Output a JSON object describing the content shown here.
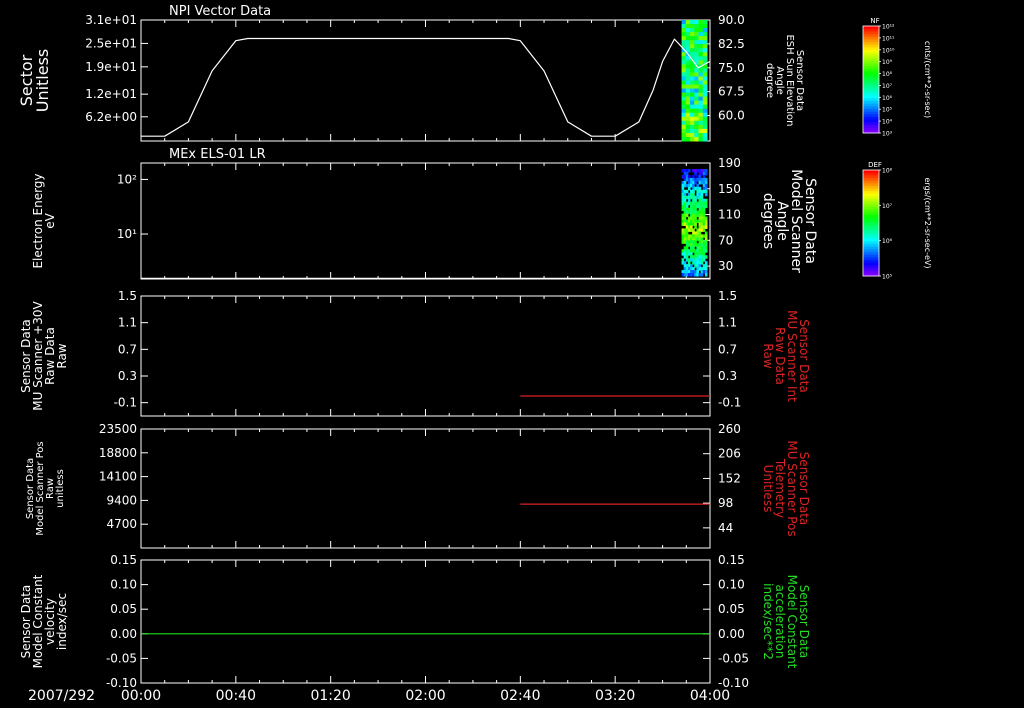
{
  "x_axis": {
    "date_label": "2007/292",
    "range": [
      0,
      240
    ],
    "ticks": [
      {
        "value": 0,
        "label": "00:00"
      },
      {
        "value": 40,
        "label": "00:40"
      },
      {
        "value": 80,
        "label": "01:20"
      },
      {
        "value": 120,
        "label": "02:00"
      },
      {
        "value": 160,
        "label": "02:40"
      },
      {
        "value": 200,
        "label": "03:20"
      },
      {
        "value": 240,
        "label": "04:00"
      }
    ]
  },
  "colors": {
    "background": "#000000",
    "axis": "#ffffff",
    "red_series": "#dd2222",
    "green_series": "#22dd22"
  },
  "chart_data": [
    {
      "type": "line",
      "title": "NPI Vector Data",
      "ylabel": [
        "Sector",
        "Unitless"
      ],
      "ylim": [
        0,
        31
      ],
      "yticks": [
        {
          "value": 6.2,
          "label": "6.2e+00"
        },
        {
          "value": 12,
          "label": "1.2e+01"
        },
        {
          "value": 19,
          "label": "1.9e+01"
        },
        {
          "value": 25,
          "label": "2.5e+01"
        },
        {
          "value": 31,
          "label": "3.1e+01"
        }
      ],
      "y2label": [
        "Sensor Data",
        "ESH Sun Elevation",
        "Angle",
        "degree"
      ],
      "y2lim": [
        52,
        90
      ],
      "y2ticks": [
        {
          "value": 60,
          "label": "60.0"
        },
        {
          "value": 67.5,
          "label": "67.5"
        },
        {
          "value": 75,
          "label": "75.0"
        },
        {
          "value": 82.5,
          "label": "82.5"
        },
        {
          "value": 90,
          "label": "90.0"
        }
      ],
      "series": [
        {
          "axis": "right",
          "color": "#ffffff",
          "x": [
            0,
            10,
            20,
            30,
            40,
            45,
            155,
            160,
            170,
            180,
            190,
            200,
            210,
            216,
            220,
            225,
            230,
            235,
            240
          ],
          "y": [
            53.5,
            53.5,
            58,
            74,
            83.5,
            84.2,
            84.2,
            83.5,
            74,
            58,
            53.5,
            53.5,
            58,
            68,
            77,
            84,
            80,
            75,
            77
          ]
        }
      ],
      "spectrogram": {
        "x_range": [
          228,
          240
        ],
        "colorbar": {
          "label_top": "NF",
          "unit": "cnts/(cm**2-sr-sec)",
          "ticks": [
            "10³",
            "10⁴",
            "10⁵",
            "10⁶",
            "10⁷",
            "10⁸",
            "10⁹",
            "10¹⁰",
            "10¹¹",
            "10¹²"
          ]
        }
      }
    },
    {
      "type": "line",
      "title": "MEx ELS-01 LR",
      "ylabel": [
        "Electron Energy",
        "eV"
      ],
      "yscale": "log",
      "ylim": [
        1.5,
        200
      ],
      "yticks": [
        {
          "value": 10,
          "label": "10¹"
        },
        {
          "value": 100,
          "label": "10²"
        }
      ],
      "y2label": [
        "Sensor Data",
        "Model Scanner",
        "Angle",
        "degrees"
      ],
      "y2lim": [
        10,
        190
      ],
      "y2ticks": [
        {
          "value": 30,
          "label": "30"
        },
        {
          "value": 70,
          "label": "70"
        },
        {
          "value": 110,
          "label": "110"
        },
        {
          "value": 150,
          "label": "150"
        },
        {
          "value": 190,
          "label": "190"
        }
      ],
      "series": [
        {
          "axis": "right",
          "color": "#ffffff",
          "x": [
            0,
            240
          ],
          "y": [
            11,
            11
          ]
        }
      ],
      "spectrogram": {
        "x_range": [
          228,
          240
        ],
        "colorbar": {
          "label_top": "DEF",
          "unit": "ergs/(cm**2-sr-sec-eV)",
          "ticks": [
            "10⁵",
            "10⁶",
            "10⁷",
            "10⁸"
          ]
        }
      }
    },
    {
      "type": "line",
      "ylabel": [
        "Sensor Data",
        "MU Scanner +30V",
        "Raw Data",
        "Raw"
      ],
      "ylim": [
        -0.3,
        1.5
      ],
      "yticks": [
        {
          "value": -0.1,
          "label": "-0.1"
        },
        {
          "value": 0.3,
          "label": "0.3"
        },
        {
          "value": 0.7,
          "label": "0.7"
        },
        {
          "value": 1.1,
          "label": "1.1"
        },
        {
          "value": 1.5,
          "label": "1.5"
        }
      ],
      "y2label": [
        "Sensor Data",
        "MU Scanner Int",
        "Raw Data",
        "Raw"
      ],
      "y2color": "#dd2222",
      "y2lim": [
        -0.3,
        1.5
      ],
      "y2ticks": [
        {
          "value": -0.1,
          "label": "-0.1"
        },
        {
          "value": 0.3,
          "label": "0.3"
        },
        {
          "value": 0.7,
          "label": "0.7"
        },
        {
          "value": 1.1,
          "label": "1.1"
        },
        {
          "value": 1.5,
          "label": "1.5"
        }
      ],
      "series": [
        {
          "axis": "right",
          "color": "#dd2222",
          "x": [
            160,
            240
          ],
          "y": [
            0,
            0
          ]
        }
      ]
    },
    {
      "type": "line",
      "ylabel": [
        "Sensor Data",
        "Model Scanner Pos",
        "Raw",
        "unitless"
      ],
      "ylim": [
        0,
        23500
      ],
      "yticks": [
        {
          "value": 4700,
          "label": "4700"
        },
        {
          "value": 9400,
          "label": "9400"
        },
        {
          "value": 14100,
          "label": "14100"
        },
        {
          "value": 18800,
          "label": "18800"
        },
        {
          "value": 23500,
          "label": "23500"
        }
      ],
      "y2label": [
        "Sensor Data",
        "MU Scanner Pos",
        "Telemetry",
        "Unitless"
      ],
      "y2color": "#dd2222",
      "y2lim": [
        0,
        260
      ],
      "y2ticks": [
        {
          "value": 44,
          "label": "44"
        },
        {
          "value": 98,
          "label": "98"
        },
        {
          "value": 152,
          "label": "152"
        },
        {
          "value": 206,
          "label": "206"
        },
        {
          "value": 260,
          "label": "260"
        }
      ],
      "series": [
        {
          "axis": "right",
          "color": "#dd2222",
          "x": [
            160,
            240
          ],
          "y": [
            96,
            96
          ]
        }
      ]
    },
    {
      "type": "line",
      "ylabel": [
        "Sensor Data",
        "Model Constant",
        "velocity",
        "index/sec"
      ],
      "ylim": [
        -0.1,
        0.15
      ],
      "yticks": [
        {
          "value": -0.1,
          "label": "-0.10"
        },
        {
          "value": -0.05,
          "label": "-0.05"
        },
        {
          "value": 0,
          "label": "0.00"
        },
        {
          "value": 0.05,
          "label": "0.05"
        },
        {
          "value": 0.1,
          "label": "0.10"
        },
        {
          "value": 0.15,
          "label": "0.15"
        }
      ],
      "y2label": [
        "Sensor Data",
        "Model Constant",
        "acceleration",
        "index/sec**2"
      ],
      "y2color": "#22dd22",
      "y2lim": [
        -0.1,
        0.15
      ],
      "y2ticks": [
        {
          "value": -0.1,
          "label": "-0.10"
        },
        {
          "value": -0.05,
          "label": "-0.05"
        },
        {
          "value": 0,
          "label": "0.00"
        },
        {
          "value": 0.05,
          "label": "0.05"
        },
        {
          "value": 0.1,
          "label": "0.10"
        },
        {
          "value": 0.15,
          "label": "0.15"
        }
      ],
      "series": [
        {
          "axis": "right",
          "color": "#22dd22",
          "x": [
            0,
            240
          ],
          "y": [
            0,
            0
          ]
        }
      ]
    }
  ]
}
